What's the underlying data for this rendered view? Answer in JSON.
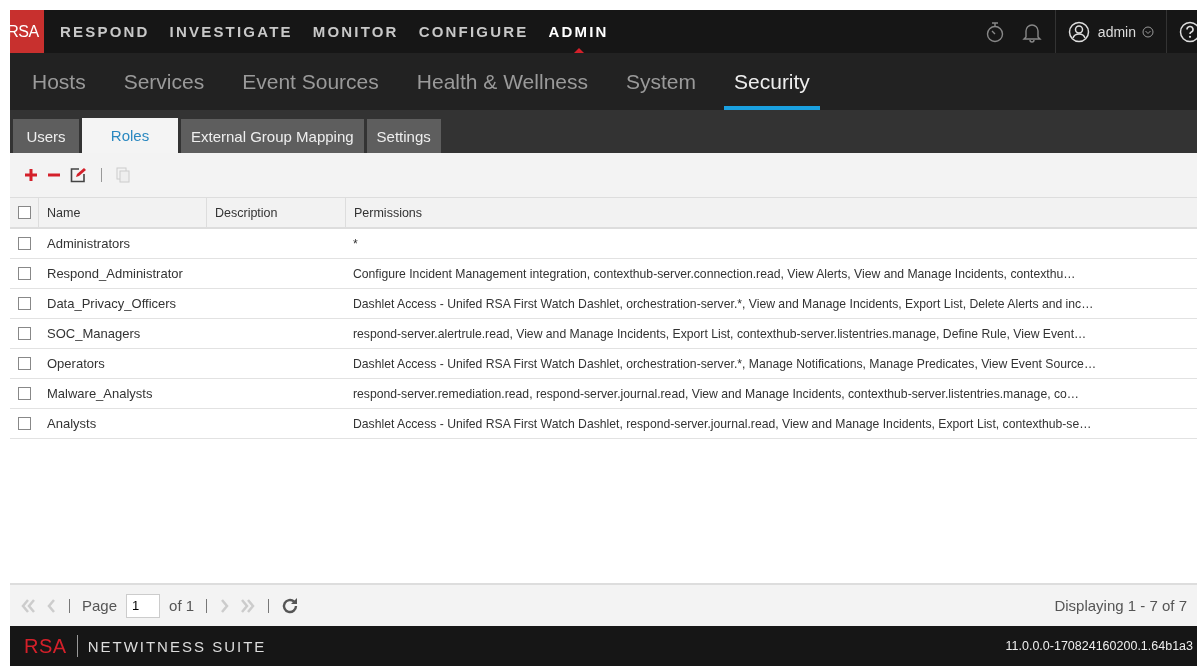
{
  "top_bar": {
    "logo": "RSA",
    "menu": [
      {
        "label": "RESPOND",
        "selected": false
      },
      {
        "label": "INVESTIGATE",
        "selected": false
      },
      {
        "label": "MONITOR",
        "selected": false
      },
      {
        "label": "CONFIGURE",
        "selected": false
      },
      {
        "label": "ADMIN",
        "selected": true
      }
    ],
    "user": "admin"
  },
  "sub_nav": [
    {
      "label": "Hosts",
      "selected": false
    },
    {
      "label": "Services",
      "selected": false
    },
    {
      "label": "Event Sources",
      "selected": false
    },
    {
      "label": "Health & Wellness",
      "selected": false
    },
    {
      "label": "System",
      "selected": false
    },
    {
      "label": "Security",
      "selected": true
    }
  ],
  "tabs": [
    {
      "label": "Users",
      "selected": false
    },
    {
      "label": "Roles",
      "selected": true
    },
    {
      "label": "External Group Mapping",
      "selected": false
    },
    {
      "label": "Settings",
      "selected": false
    }
  ],
  "table": {
    "select_all_checked": false,
    "columns": [
      "Name",
      "Description",
      "Permissions"
    ],
    "rows": [
      {
        "checked": false,
        "name": "Administrators",
        "permissions": "*"
      },
      {
        "checked": false,
        "name": "Respond_Administrator",
        "permissions": "Configure Incident Management integration, contexthub-server.connection.read, View Alerts, View and Manage Incidents, contexthu…"
      },
      {
        "checked": false,
        "name": "Data_Privacy_Officers",
        "permissions": "Dashlet Access - Unifed RSA First Watch Dashlet, orchestration-server.*, View and Manage Incidents, Export List, Delete Alerts and inc…"
      },
      {
        "checked": false,
        "name": "SOC_Managers",
        "permissions": "respond-server.alertrule.read, View and Manage Incidents, Export List, contexthub-server.listentries.manage, Define Rule, View Event…"
      },
      {
        "checked": false,
        "name": "Operators",
        "permissions": "Dashlet Access - Unifed RSA First Watch Dashlet, orchestration-server.*, Manage Notifications, Manage Predicates, View Event Source…"
      },
      {
        "checked": false,
        "name": "Malware_Analysts",
        "permissions": "respond-server.remediation.read, respond-server.journal.read, View and Manage Incidents, contexthub-server.listentries.manage, co…"
      },
      {
        "checked": false,
        "name": "Analysts",
        "permissions": "Dashlet Access - Unifed RSA First Watch Dashlet, respond-server.journal.read, View and Manage Incidents, Export List, contexthub-se…"
      }
    ]
  },
  "pager": {
    "page_label": "Page",
    "page": "1",
    "of_label": "of 1",
    "display": "Displaying 1 - 7 of 7"
  },
  "footer": {
    "logo": "RSA",
    "product": "NETWITNESS SUITE",
    "version": "11.0.0.0-170824160200.1.64b1a3"
  }
}
